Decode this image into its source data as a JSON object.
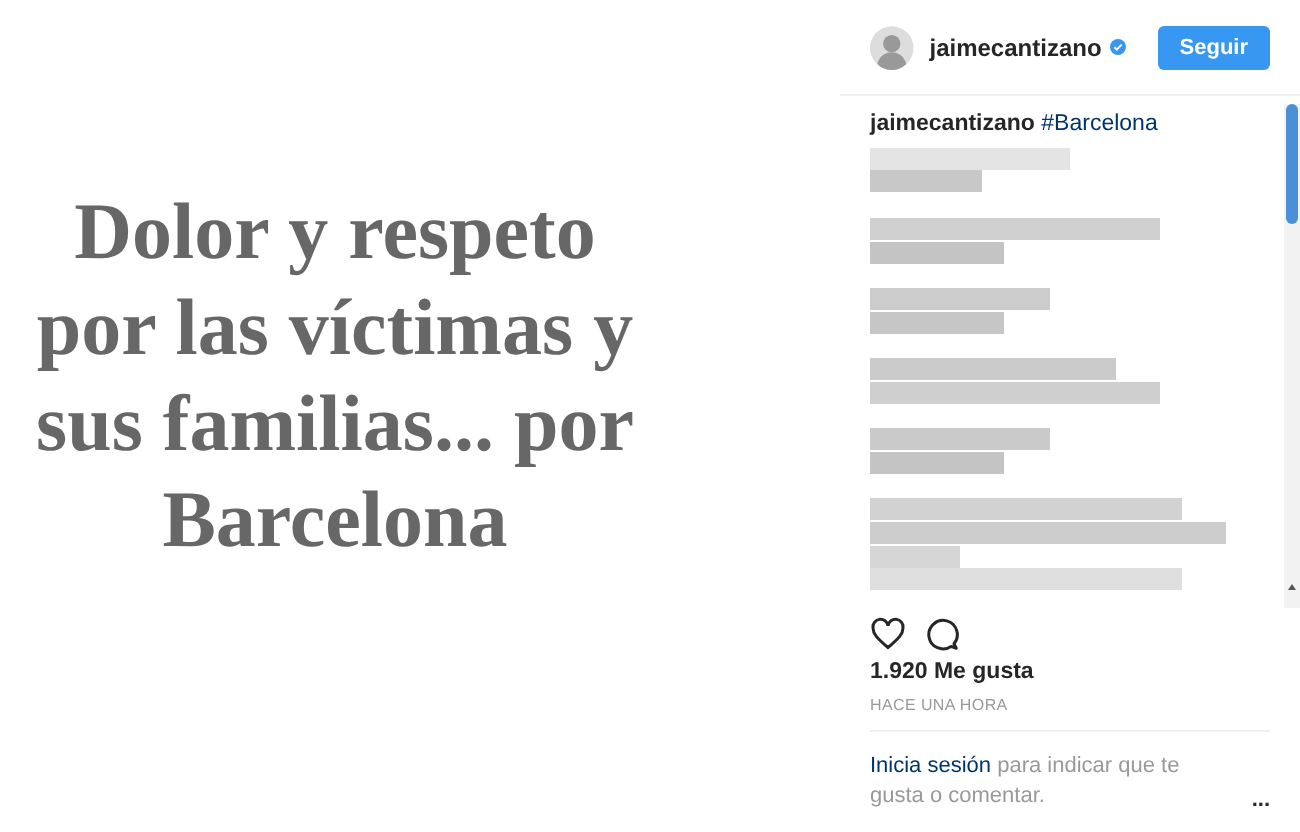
{
  "post_image": {
    "text": "Dolor y respeto por las víctimas y sus familias... por Barcelona"
  },
  "header": {
    "username": "jaimecantizano",
    "verified": true,
    "follow_button": "Seguir"
  },
  "caption": {
    "username": "jaimecantizano",
    "text": "#Barcelona"
  },
  "likes": "1.920 Me gusta",
  "time": "HACE UNA HORA",
  "login": {
    "link": "Inicia sesión",
    "text": "para indicar que te gusta o comentar."
  },
  "more": "..."
}
